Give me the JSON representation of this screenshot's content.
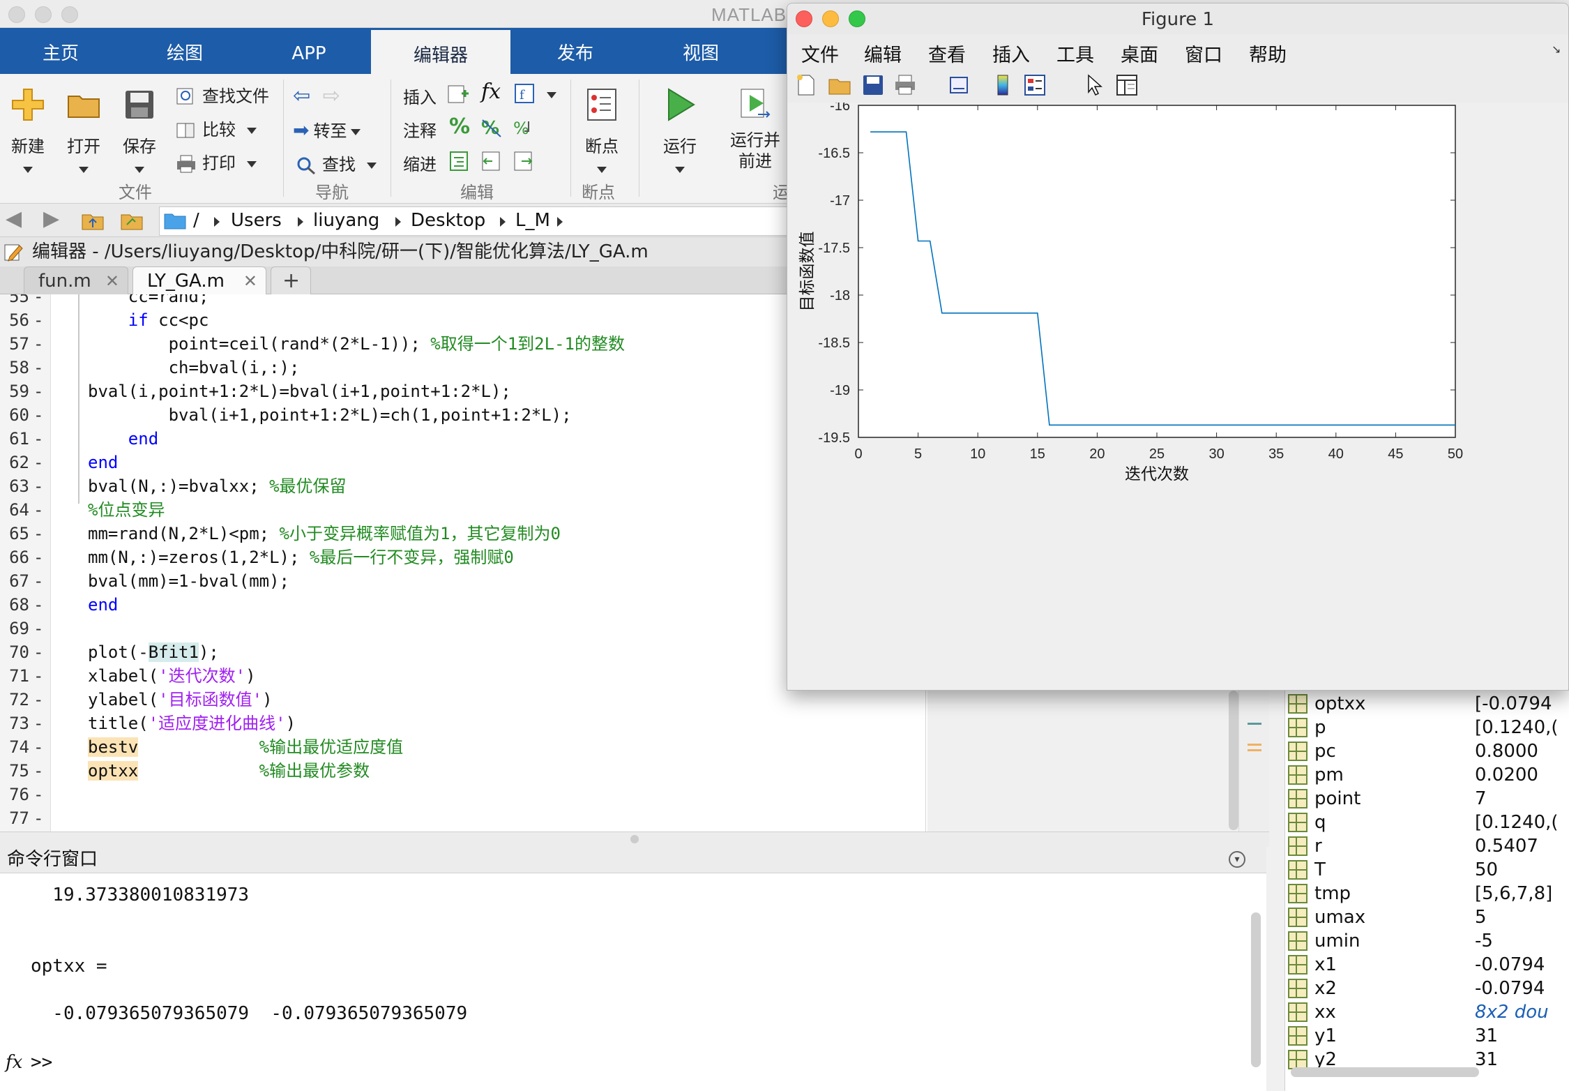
{
  "window": {
    "title": "MATLAB"
  },
  "ribbon_tabs": [
    "主页",
    "绘图",
    "APP",
    "编辑器",
    "发布",
    "视图"
  ],
  "ribbon": {
    "file": {
      "new": "新建",
      "open": "打开",
      "save": "保存",
      "find_files": "查找文件",
      "compare": "比较",
      "print": "打印",
      "group": "文件"
    },
    "navigate": {
      "goto": "转至",
      "find": "查找",
      "group": "导航"
    },
    "edit": {
      "insert": "插入",
      "comment": "注释",
      "indent": "缩进",
      "fx": "fx",
      "percent": "%",
      "group": "编辑"
    },
    "breakpoints": {
      "label": "断点",
      "group": "断点"
    },
    "run": {
      "run": "运行",
      "run_advance": "运行并\n前进",
      "group_partial": "运"
    }
  },
  "path": {
    "root": "/",
    "crumbs": [
      "Users",
      "liuyang",
      "Desktop",
      "L_M"
    ]
  },
  "editor": {
    "header": "编辑器 - /Users/liuyang/Desktop/中科院/研一(下)/智能优化算法/LY_GA.m",
    "tabs": [
      "fun.m",
      "LY_GA.m"
    ],
    "add_tab": "+",
    "lines": [
      {
        "n": "55",
        "segs": [
          {
            "t": "    cc=rand;",
            "c": ""
          }
        ]
      },
      {
        "n": "56",
        "segs": [
          {
            "t": "    ",
            "c": ""
          },
          {
            "t": "if",
            "c": "kw"
          },
          {
            "t": " cc<pc",
            "c": ""
          }
        ]
      },
      {
        "n": "57",
        "segs": [
          {
            "t": "        point=ceil(rand*(2*L-1)); ",
            "c": ""
          },
          {
            "t": "%取得一个1到2L-1的整数",
            "c": "cm"
          }
        ]
      },
      {
        "n": "58",
        "segs": [
          {
            "t": "        ch=bval(i,:);",
            "c": ""
          }
        ]
      },
      {
        "n": "59",
        "segs": [
          {
            "t": "bval(i,point+1:2*L)=bval(i+1,point+1:2*L);",
            "c": ""
          }
        ]
      },
      {
        "n": "60",
        "segs": [
          {
            "t": "        bval(i+1,point+1:2*L)=ch(1,point+1:2*L);",
            "c": ""
          }
        ]
      },
      {
        "n": "61",
        "segs": [
          {
            "t": "    ",
            "c": ""
          },
          {
            "t": "end",
            "c": "kw"
          }
        ]
      },
      {
        "n": "62",
        "segs": [
          {
            "t": "end",
            "c": "kw"
          }
        ]
      },
      {
        "n": "63",
        "segs": [
          {
            "t": "bval(N,:)=bvalxx; ",
            "c": ""
          },
          {
            "t": "%最优保留",
            "c": "cm"
          }
        ]
      },
      {
        "n": "64",
        "segs": [
          {
            "t": "%位点变异",
            "c": "cm"
          }
        ]
      },
      {
        "n": "65",
        "segs": [
          {
            "t": "mm=rand(N,2*L)<pm; ",
            "c": ""
          },
          {
            "t": "%小于变异概率赋值为1，其它复制为0",
            "c": "cm"
          }
        ]
      },
      {
        "n": "66",
        "segs": [
          {
            "t": "mm(N,:)=zeros(1,2*L); ",
            "c": ""
          },
          {
            "t": "%最后一行不变异，强制赋0",
            "c": "cm"
          }
        ]
      },
      {
        "n": "67",
        "segs": [
          {
            "t": "bval(mm)=1-bval(mm);",
            "c": ""
          }
        ]
      },
      {
        "n": "68",
        "segs": [
          {
            "t": "end",
            "c": "kw"
          }
        ]
      },
      {
        "n": "69",
        "segs": []
      },
      {
        "n": "70",
        "segs": [
          {
            "t": "plot(-",
            "c": ""
          },
          {
            "t": "Bfit1",
            "c": "hl-sel"
          },
          {
            "t": ");",
            "c": ""
          }
        ]
      },
      {
        "n": "71",
        "segs": [
          {
            "t": "xlabel(",
            "c": ""
          },
          {
            "t": "'迭代次数'",
            "c": "str"
          },
          {
            "t": ")",
            "c": ""
          }
        ]
      },
      {
        "n": "72",
        "segs": [
          {
            "t": "ylabel(",
            "c": ""
          },
          {
            "t": "'目标函数值'",
            "c": "str"
          },
          {
            "t": ")",
            "c": ""
          }
        ]
      },
      {
        "n": "73",
        "segs": [
          {
            "t": "title(",
            "c": ""
          },
          {
            "t": "'适应度进化曲线'",
            "c": "str"
          },
          {
            "t": ")",
            "c": ""
          }
        ]
      },
      {
        "n": "74",
        "segs": [
          {
            "t": "bestv",
            "c": "hl-warn"
          },
          {
            "t": "            ",
            "c": ""
          },
          {
            "t": "%输出最优适应度值",
            "c": "cm"
          }
        ]
      },
      {
        "n": "75",
        "segs": [
          {
            "t": "optxx",
            "c": "hl-warn"
          },
          {
            "t": "            ",
            "c": ""
          },
          {
            "t": "%输出最优参数",
            "c": "cm"
          }
        ]
      },
      {
        "n": "76",
        "segs": []
      },
      {
        "n": "77",
        "segs": []
      }
    ]
  },
  "command_window": {
    "title": "命令行窗口",
    "lines": [
      "  19.373380010831973",
      "",
      "",
      "optxx =",
      "",
      "  -0.079365079365079  -0.079365079365079"
    ],
    "prompt": ">>",
    "fx": "fx"
  },
  "workspace": {
    "rows": [
      {
        "name": "optxx",
        "value": "[-0.0794"
      },
      {
        "name": "p",
        "value": "[0.1240,("
      },
      {
        "name": "pc",
        "value": "0.8000"
      },
      {
        "name": "pm",
        "value": "0.0200"
      },
      {
        "name": "point",
        "value": "7"
      },
      {
        "name": "q",
        "value": "[0.1240,("
      },
      {
        "name": "r",
        "value": "0.5407"
      },
      {
        "name": "T",
        "value": "50"
      },
      {
        "name": "tmp",
        "value": "[5,6,7,8]"
      },
      {
        "name": "umax",
        "value": "5"
      },
      {
        "name": "umin",
        "value": "-5"
      },
      {
        "name": "x1",
        "value": "-0.0794"
      },
      {
        "name": "x2",
        "value": "-0.0794"
      },
      {
        "name": "xx",
        "value": "8x2 dou",
        "italic": true
      },
      {
        "name": "y1",
        "value": "31"
      },
      {
        "name": "y2",
        "value": "31"
      }
    ]
  },
  "figure": {
    "title": "Figure 1",
    "menu": [
      "文件",
      "编辑",
      "查看",
      "插入",
      "工具",
      "桌面",
      "窗口",
      "帮助"
    ],
    "line_color": "#0072bd"
  },
  "chart_data": {
    "type": "line",
    "title": "适应度进化曲线",
    "xlabel": "迭代次数",
    "ylabel": "目标函数值",
    "xlim": [
      0,
      50
    ],
    "ylim": [
      -19.5,
      -16
    ],
    "xticks": [
      0,
      5,
      10,
      15,
      20,
      25,
      30,
      35,
      40,
      45,
      50
    ],
    "yticks": [
      -16,
      -16.5,
      -17,
      -17.5,
      -18,
      -18.5,
      -19,
      -19.5
    ],
    "grid": false,
    "series": [
      {
        "x": [
          1,
          2,
          3,
          4,
          5,
          6,
          7,
          8,
          9,
          10,
          11,
          12,
          13,
          14,
          15,
          16,
          17,
          18,
          19,
          20,
          21,
          22,
          23,
          24,
          25,
          26,
          27,
          28,
          29,
          30,
          31,
          32,
          33,
          34,
          35,
          36,
          37,
          38,
          39,
          40,
          41,
          42,
          43,
          44,
          45,
          46,
          47,
          48,
          49,
          50
        ],
        "values": [
          -16.28,
          -16.28,
          -16.28,
          -16.28,
          -17.43,
          -17.43,
          -18.19,
          -18.19,
          -18.19,
          -18.19,
          -18.19,
          -18.19,
          -18.19,
          -18.19,
          -18.19,
          -19.37,
          -19.37,
          -19.37,
          -19.37,
          -19.37,
          -19.37,
          -19.37,
          -19.37,
          -19.37,
          -19.37,
          -19.37,
          -19.37,
          -19.37,
          -19.37,
          -19.37,
          -19.37,
          -19.37,
          -19.37,
          -19.37,
          -19.37,
          -19.37,
          -19.37,
          -19.37,
          -19.37,
          -19.37,
          -19.37,
          -19.37,
          -19.37,
          -19.37,
          -19.37,
          -19.37,
          -19.37,
          -19.37,
          -19.37,
          -19.37
        ]
      }
    ]
  }
}
